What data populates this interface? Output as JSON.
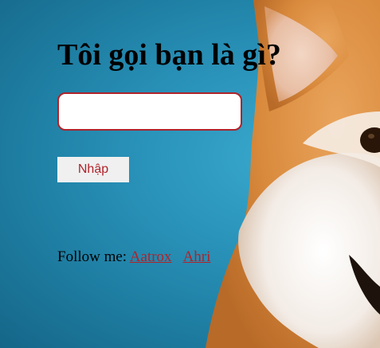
{
  "page": {
    "heading": "Tôi gọi bạn là gì?",
    "name_input": {
      "value": "",
      "placeholder": ""
    },
    "submit_label": "Nhập",
    "follow": {
      "label": "Follow me:",
      "links": [
        "Aatrox",
        "Ahri"
      ]
    }
  },
  "colors": {
    "background": "#2a93ba",
    "accent": "#b0232a",
    "button_bg": "#f0f0f0"
  },
  "background_image": {
    "subject": "shiba-inu-dog-photo"
  }
}
